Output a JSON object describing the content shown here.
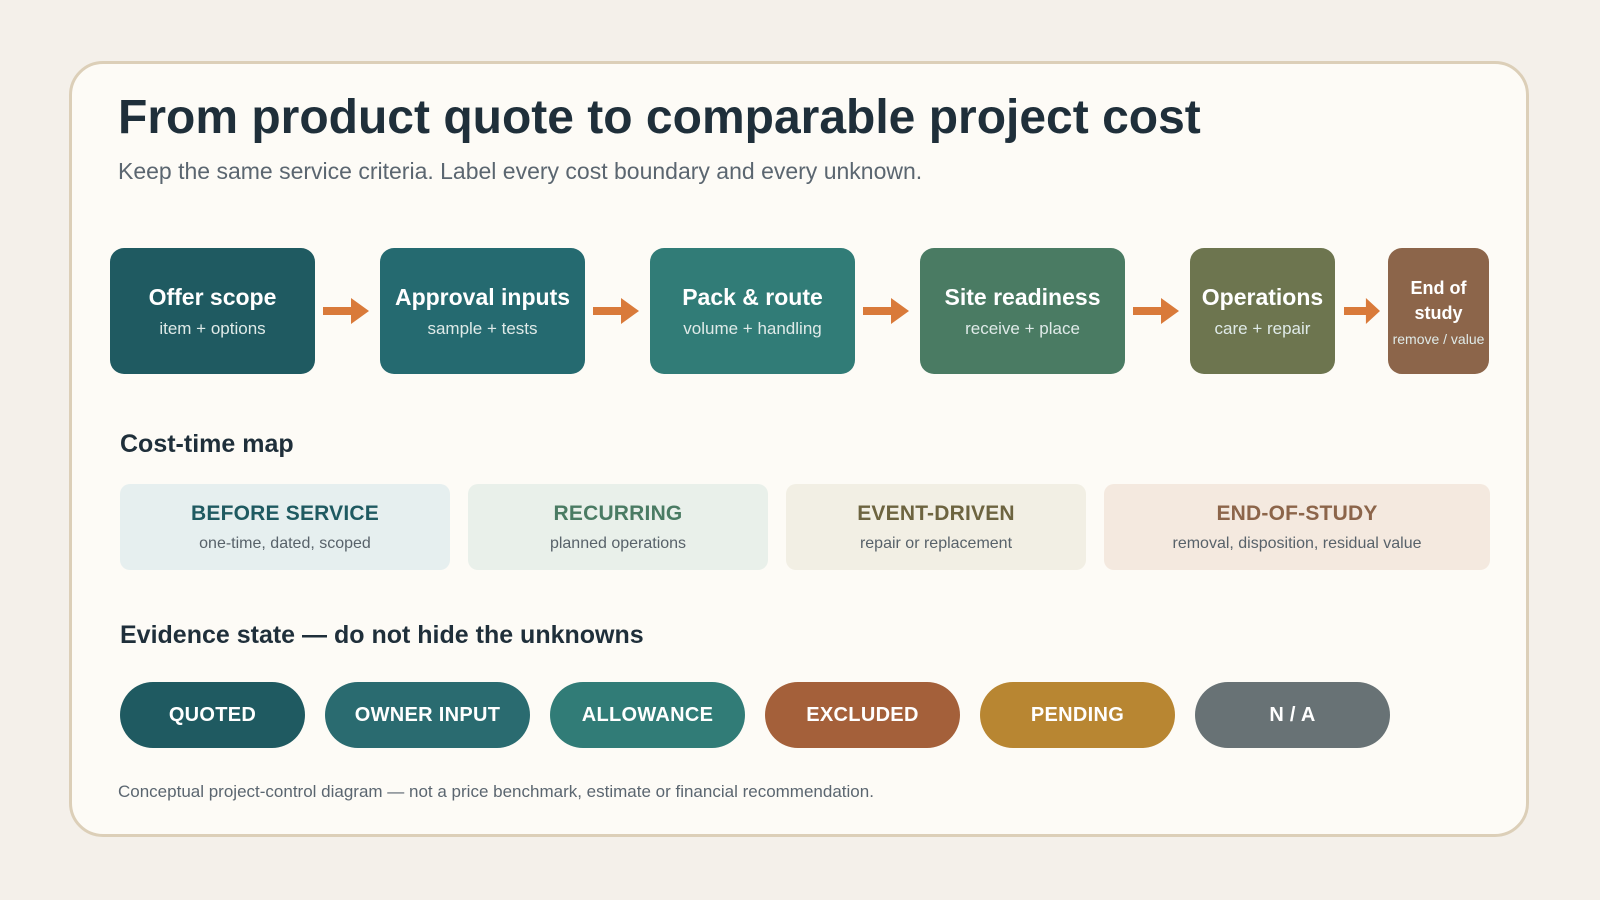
{
  "header": {
    "title": "From product quote to comparable project cost",
    "subtitle": "Keep the same service criteria. Label every cost boundary and every unknown."
  },
  "flow": {
    "steps": [
      {
        "title": "Offer scope",
        "sub": "item + options",
        "color": "#1f5a61"
      },
      {
        "title": "Approval inputs",
        "sub": "sample + tests",
        "color": "#256a70"
      },
      {
        "title": "Pack & route",
        "sub": "volume + handling",
        "color": "#317c77"
      },
      {
        "title": "Site readiness",
        "sub": "receive + place",
        "color": "#4a7b63"
      },
      {
        "title": "Operations",
        "sub": "care + repair",
        "color": "#6d754f"
      },
      {
        "title": "End of study",
        "sub": "remove / value",
        "color": "#8c654a"
      }
    ],
    "arrow_color": "#d97a3a"
  },
  "cost_time": {
    "heading": "Cost-time map",
    "boxes": [
      {
        "title": "BEFORE SERVICE",
        "sub": "one-time, dated, scoped",
        "bg": "#e6efef",
        "fg": "#1f5a61"
      },
      {
        "title": "RECURRING",
        "sub": "planned operations",
        "bg": "#e9f0ea",
        "fg": "#4a7b63"
      },
      {
        "title": "EVENT-DRIVEN",
        "sub": "repair or replacement",
        "bg": "#f2efe4",
        "fg": "#6d6440"
      },
      {
        "title": "END-OF-STUDY",
        "sub": "removal, disposition, residual value",
        "bg": "#f4e9df",
        "fg": "#8c654a"
      }
    ]
  },
  "evidence": {
    "heading": "Evidence state — do not hide the unknowns",
    "pills": [
      {
        "label": "QUOTED",
        "color": "#1f5a61"
      },
      {
        "label": "OWNER INPUT",
        "color": "#2a6b70"
      },
      {
        "label": "ALLOWANCE",
        "color": "#317c77"
      },
      {
        "label": "EXCLUDED",
        "color": "#a4603a"
      },
      {
        "label": "PENDING",
        "color": "#b88632"
      },
      {
        "label": "N / A",
        "color": "#687275"
      }
    ]
  },
  "footnote": "Conceptual project-control diagram — not a price benchmark, estimate or financial recommendation."
}
